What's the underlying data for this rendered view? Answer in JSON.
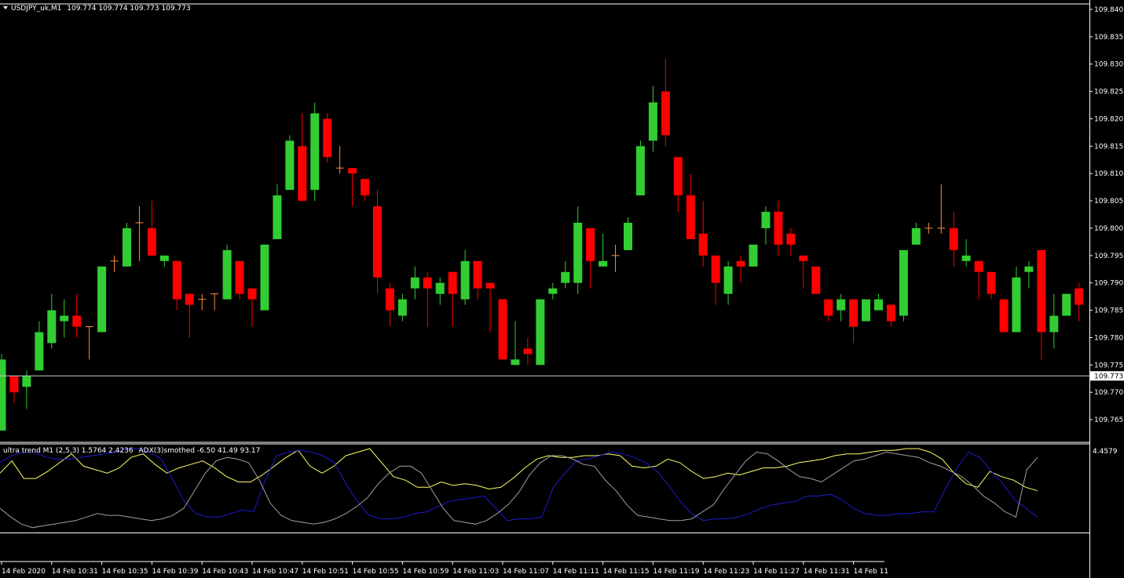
{
  "main_header": {
    "symbol": "USDJPY_uk,M1",
    "ohlc": "109.774 109.774 109.773 109.773"
  },
  "indicator_header": {
    "ultra_trend": "ultra trend M1 (2,5,3) 1.5764 2.4236",
    "adx": "ADX(3)smothed -6.50 41.49 93.17"
  },
  "colors": {
    "background": "#000000",
    "bull": "#32cd32",
    "bear": "#ff0000",
    "doji": "#ff8c3a",
    "frame": "#ffffff",
    "yellow_line": "#ffff66",
    "blue_line": "#1c1ccf",
    "gray_line": "#a0a0a0"
  },
  "chart_data": [
    {
      "type": "candlestick",
      "ylim": [
        109.761,
        109.841
      ],
      "y_ticks": [
        "109.840",
        "109.835",
        "109.830",
        "109.825",
        "109.820",
        "109.815",
        "109.810",
        "109.805",
        "109.800",
        "109.795",
        "109.790",
        "109.785",
        "109.780",
        "109.775",
        "109.770",
        "109.765"
      ],
      "current_price": "109.773",
      "x_ticks": [
        "14 Feb 2020",
        "14 Feb 10:31",
        "14 Feb 10:35",
        "14 Feb 10:39",
        "14 Feb 10:43",
        "14 Feb 10:47",
        "14 Feb 10:51",
        "14 Feb 10:55",
        "14 Feb 10:59",
        "14 Feb 11:03",
        "14 Feb 11:07",
        "14 Feb 11:11",
        "14 Feb 11:15",
        "14 Feb 11:19",
        "14 Feb 11:23",
        "14 Feb 11:27",
        "14 Feb 11:31",
        "14 Feb 11"
      ],
      "candles": [
        {
          "o": 109.763,
          "h": 109.777,
          "l": 109.763,
          "c": 109.776
        },
        {
          "o": 109.773,
          "h": 109.773,
          "l": 109.768,
          "c": 109.77
        },
        {
          "o": 109.771,
          "h": 109.774,
          "l": 109.767,
          "c": 109.773
        },
        {
          "o": 109.774,
          "h": 109.783,
          "l": 109.774,
          "c": 109.781
        },
        {
          "o": 109.779,
          "h": 109.788,
          "l": 109.778,
          "c": 109.785
        },
        {
          "o": 109.783,
          "h": 109.787,
          "l": 109.78,
          "c": 109.784
        },
        {
          "o": 109.784,
          "h": 109.788,
          "l": 109.78,
          "c": 109.782
        },
        {
          "o": 109.782,
          "h": 109.782,
          "l": 109.776,
          "c": 109.782
        },
        {
          "o": 109.781,
          "h": 109.793,
          "l": 109.781,
          "c": 109.793
        },
        {
          "o": 109.794,
          "h": 109.795,
          "l": 109.792,
          "c": 109.794
        },
        {
          "o": 109.793,
          "h": 109.801,
          "l": 109.793,
          "c": 109.8
        },
        {
          "o": 109.801,
          "h": 109.804,
          "l": 109.794,
          "c": 109.801
        },
        {
          "o": 109.8,
          "h": 109.805,
          "l": 109.795,
          "c": 109.795
        },
        {
          "o": 109.794,
          "h": 109.795,
          "l": 109.793,
          "c": 109.795
        },
        {
          "o": 109.794,
          "h": 109.794,
          "l": 109.785,
          "c": 109.787
        },
        {
          "o": 109.788,
          "h": 109.788,
          "l": 109.78,
          "c": 109.786
        },
        {
          "o": 109.787,
          "h": 109.788,
          "l": 109.785,
          "c": 109.787
        },
        {
          "o": 109.788,
          "h": 109.788,
          "l": 109.785,
          "c": 109.788
        },
        {
          "o": 109.787,
          "h": 109.797,
          "l": 109.787,
          "c": 109.796
        },
        {
          "o": 109.794,
          "h": 109.794,
          "l": 109.787,
          "c": 109.788
        },
        {
          "o": 109.789,
          "h": 109.789,
          "l": 109.782,
          "c": 109.787
        },
        {
          "o": 109.785,
          "h": 109.797,
          "l": 109.785,
          "c": 109.797
        },
        {
          "o": 109.798,
          "h": 109.808,
          "l": 109.798,
          "c": 109.806
        },
        {
          "o": 109.807,
          "h": 109.817,
          "l": 109.807,
          "c": 109.816
        },
        {
          "o": 109.815,
          "h": 109.821,
          "l": 109.805,
          "c": 109.805
        },
        {
          "o": 109.807,
          "h": 109.823,
          "l": 109.805,
          "c": 109.821
        },
        {
          "o": 109.82,
          "h": 109.821,
          "l": 109.812,
          "c": 109.813
        },
        {
          "o": 109.811,
          "h": 109.815,
          "l": 109.81,
          "c": 109.811
        },
        {
          "o": 109.811,
          "h": 109.811,
          "l": 109.804,
          "c": 109.81
        },
        {
          "o": 109.809,
          "h": 109.809,
          "l": 109.805,
          "c": 109.806
        },
        {
          "o": 109.804,
          "h": 109.807,
          "l": 109.788,
          "c": 109.791
        },
        {
          "o": 109.789,
          "h": 109.79,
          "l": 109.782,
          "c": 109.785
        },
        {
          "o": 109.784,
          "h": 109.788,
          "l": 109.783,
          "c": 109.787
        },
        {
          "o": 109.789,
          "h": 109.793,
          "l": 109.787,
          "c": 109.791
        },
        {
          "o": 109.791,
          "h": 109.792,
          "l": 109.782,
          "c": 109.789
        },
        {
          "o": 109.788,
          "h": 109.791,
          "l": 109.786,
          "c": 109.79
        },
        {
          "o": 109.792,
          "h": 109.792,
          "l": 109.782,
          "c": 109.788
        },
        {
          "o": 109.787,
          "h": 109.796,
          "l": 109.786,
          "c": 109.794
        },
        {
          "o": 109.794,
          "h": 109.794,
          "l": 109.787,
          "c": 109.789
        },
        {
          "o": 109.79,
          "h": 109.79,
          "l": 109.781,
          "c": 109.789
        },
        {
          "o": 109.787,
          "h": 109.787,
          "l": 109.776,
          "c": 109.776
        },
        {
          "o": 109.775,
          "h": 109.783,
          "l": 109.775,
          "c": 109.776
        },
        {
          "o": 109.778,
          "h": 109.78,
          "l": 109.775,
          "c": 109.777
        },
        {
          "o": 109.775,
          "h": 109.787,
          "l": 109.775,
          "c": 109.787
        },
        {
          "o": 109.788,
          "h": 109.79,
          "l": 109.787,
          "c": 109.789
        },
        {
          "o": 109.79,
          "h": 109.794,
          "l": 109.789,
          "c": 109.792
        },
        {
          "o": 109.79,
          "h": 109.804,
          "l": 109.788,
          "c": 109.801
        },
        {
          "o": 109.8,
          "h": 109.8,
          "l": 109.789,
          "c": 109.794
        },
        {
          "o": 109.793,
          "h": 109.799,
          "l": 109.793,
          "c": 109.794
        },
        {
          "o": 109.795,
          "h": 109.797,
          "l": 109.792,
          "c": 109.795
        },
        {
          "o": 109.796,
          "h": 109.802,
          "l": 109.796,
          "c": 109.801
        },
        {
          "o": 109.806,
          "h": 109.816,
          "l": 109.806,
          "c": 109.815
        },
        {
          "o": 109.816,
          "h": 109.826,
          "l": 109.814,
          "c": 109.823
        },
        {
          "o": 109.825,
          "h": 109.831,
          "l": 109.815,
          "c": 109.817
        },
        {
          "o": 109.813,
          "h": 109.813,
          "l": 109.803,
          "c": 109.806
        },
        {
          "o": 109.806,
          "h": 109.81,
          "l": 109.799,
          "c": 109.798
        },
        {
          "o": 109.799,
          "h": 109.805,
          "l": 109.793,
          "c": 109.795
        },
        {
          "o": 109.795,
          "h": 109.795,
          "l": 109.786,
          "c": 109.79
        },
        {
          "o": 109.788,
          "h": 109.794,
          "l": 109.786,
          "c": 109.793
        },
        {
          "o": 109.794,
          "h": 109.795,
          "l": 109.79,
          "c": 109.793
        },
        {
          "o": 109.793,
          "h": 109.797,
          "l": 109.793,
          "c": 109.797
        },
        {
          "o": 109.8,
          "h": 109.804,
          "l": 109.797,
          "c": 109.803
        },
        {
          "o": 109.803,
          "h": 109.805,
          "l": 109.795,
          "c": 109.797
        },
        {
          "o": 109.799,
          "h": 109.8,
          "l": 109.795,
          "c": 109.797
        },
        {
          "o": 109.795,
          "h": 109.795,
          "l": 109.789,
          "c": 109.794
        },
        {
          "o": 109.793,
          "h": 109.793,
          "l": 109.788,
          "c": 109.788
        },
        {
          "o": 109.787,
          "h": 109.787,
          "l": 109.783,
          "c": 109.784
        },
        {
          "o": 109.785,
          "h": 109.788,
          "l": 109.783,
          "c": 109.787
        },
        {
          "o": 109.787,
          "h": 109.787,
          "l": 109.779,
          "c": 109.782
        },
        {
          "o": 109.783,
          "h": 109.787,
          "l": 109.783,
          "c": 109.787
        },
        {
          "o": 109.785,
          "h": 109.788,
          "l": 109.785,
          "c": 109.787
        },
        {
          "o": 109.786,
          "h": 109.786,
          "l": 109.782,
          "c": 109.783
        },
        {
          "o": 109.784,
          "h": 109.791,
          "l": 109.783,
          "c": 109.796
        },
        {
          "o": 109.797,
          "h": 109.801,
          "l": 109.797,
          "c": 109.8
        },
        {
          "o": 109.8,
          "h": 109.801,
          "l": 109.799,
          "c": 109.8
        },
        {
          "o": 109.8,
          "h": 109.808,
          "l": 109.799,
          "c": 109.8
        },
        {
          "o": 109.8,
          "h": 109.803,
          "l": 109.793,
          "c": 109.796
        },
        {
          "o": 109.794,
          "h": 109.798,
          "l": 109.793,
          "c": 109.795
        },
        {
          "o": 109.794,
          "h": 109.794,
          "l": 109.787,
          "c": 109.792
        },
        {
          "o": 109.792,
          "h": 109.792,
          "l": 109.787,
          "c": 109.788
        },
        {
          "o": 109.787,
          "h": 109.787,
          "l": 109.781,
          "c": 109.781
        },
        {
          "o": 109.781,
          "h": 109.793,
          "l": 109.781,
          "c": 109.791
        },
        {
          "o": 109.792,
          "h": 109.794,
          "l": 109.789,
          "c": 109.793
        },
        {
          "o": 109.796,
          "h": 109.796,
          "l": 109.776,
          "c": 109.781
        },
        {
          "o": 109.781,
          "h": 109.788,
          "l": 109.778,
          "c": 109.784
        },
        {
          "o": 109.784,
          "h": 109.788,
          "l": 109.784,
          "c": 109.788
        },
        {
          "o": 109.789,
          "h": 109.79,
          "l": 109.783,
          "c": 109.786
        }
      ]
    },
    {
      "type": "line",
      "name": "ultra trend M1 (2,5,3) / ADX(3)smothed",
      "ylim": [
        0,
        4.6
      ],
      "y_ticks": [
        "4.4579"
      ],
      "series": [
        {
          "color": "yellow",
          "values": [
            3.2,
            3.9,
            2.9,
            2.9,
            3.3,
            3.8,
            4.3,
            3.6,
            3.4,
            3.2,
            3.5,
            4.1,
            4.3,
            3.7,
            3.2,
            3.5,
            3.7,
            3.9,
            3.5,
            3.0,
            2.7,
            2.7,
            3.1,
            3.6,
            4.1,
            4.5,
            3.6,
            3.2,
            3.6,
            4.2,
            4.4,
            4.6,
            3.8,
            3.0,
            2.8,
            2.4,
            2.4,
            2.7,
            2.5,
            2.6,
            2.5,
            2.3,
            2.4,
            2.9,
            3.5,
            4.0,
            4.2,
            4.1,
            4.1,
            4.2,
            4.2,
            4.3,
            4.2,
            3.6,
            3.5,
            3.6,
            4.0,
            3.8,
            3.3,
            2.9,
            3.0,
            3.2,
            3.1,
            3.3,
            3.5,
            3.5,
            3.6,
            3.8,
            3.9,
            4.0,
            4.2,
            4.3,
            4.3,
            4.4,
            4.5,
            4.5,
            4.6,
            4.6,
            4.4,
            4.0,
            3.2,
            2.6,
            2.4,
            3.3,
            3.0,
            2.8,
            2.4,
            2.2
          ]
        },
        {
          "color": "blue",
          "values": [
            3.8,
            4.2,
            4.4,
            4.4,
            4.1,
            4.0,
            4.0,
            4.1,
            4.2,
            4.3,
            4.4,
            4.6,
            4.6,
            4.4,
            4.0,
            2.8,
            1.6,
            0.9,
            0.7,
            0.7,
            0.9,
            1.1,
            1.0,
            2.8,
            4.2,
            4.4,
            4.5,
            4.4,
            4.2,
            3.8,
            2.6,
            1.6,
            0.8,
            0.6,
            0.6,
            0.7,
            0.9,
            1.0,
            1.3,
            1.6,
            1.7,
            1.8,
            1.9,
            1.2,
            0.5,
            0.6,
            0.6,
            0.7,
            2.4,
            3.2,
            3.9,
            4.0,
            4.2,
            4.4,
            4.3,
            4.1,
            3.8,
            3.3,
            2.5,
            1.6,
            0.9,
            0.5,
            0.6,
            0.6,
            0.7,
            0.9,
            1.2,
            1.4,
            1.5,
            1.6,
            1.9,
            1.9,
            2.0,
            1.7,
            1.2,
            0.9,
            0.8,
            0.8,
            0.9,
            0.9,
            1.0,
            1.0,
            2.3,
            3.5,
            4.4,
            4.1,
            3.3,
            2.6,
            1.7,
            1.2,
            0.7
          ]
        },
        {
          "color": "gray",
          "values": [
            1.2,
            0.7,
            0.3,
            0.1,
            0.2,
            0.3,
            0.4,
            0.5,
            0.7,
            0.9,
            0.8,
            0.8,
            0.7,
            0.6,
            0.5,
            0.6,
            0.8,
            1.2,
            2.2,
            3.2,
            3.9,
            4.1,
            4.0,
            3.8,
            2.8,
            1.5,
            0.8,
            0.5,
            0.4,
            0.3,
            0.4,
            0.6,
            0.9,
            1.3,
            1.8,
            2.6,
            3.2,
            3.6,
            3.6,
            3.2,
            2.2,
            1.2,
            0.5,
            0.4,
            0.3,
            0.5,
            0.9,
            1.4,
            2.1,
            3.1,
            3.8,
            4.2,
            4.2,
            4.0,
            3.7,
            3.6,
            2.8,
            2.2,
            1.4,
            0.8,
            0.7,
            0.6,
            0.5,
            0.5,
            0.6,
            1.0,
            1.4,
            2.3,
            3.1,
            3.9,
            4.4,
            4.3,
            3.9,
            3.4,
            3.0,
            2.9,
            2.7,
            3.1,
            3.5,
            3.9,
            4.0,
            4.2,
            4.4,
            4.3,
            4.2,
            4.1,
            3.8,
            3.6,
            3.3,
            3.0,
            2.5,
            1.9,
            1.5,
            1.0,
            0.7,
            3.4,
            4.1
          ]
        }
      ]
    }
  ]
}
